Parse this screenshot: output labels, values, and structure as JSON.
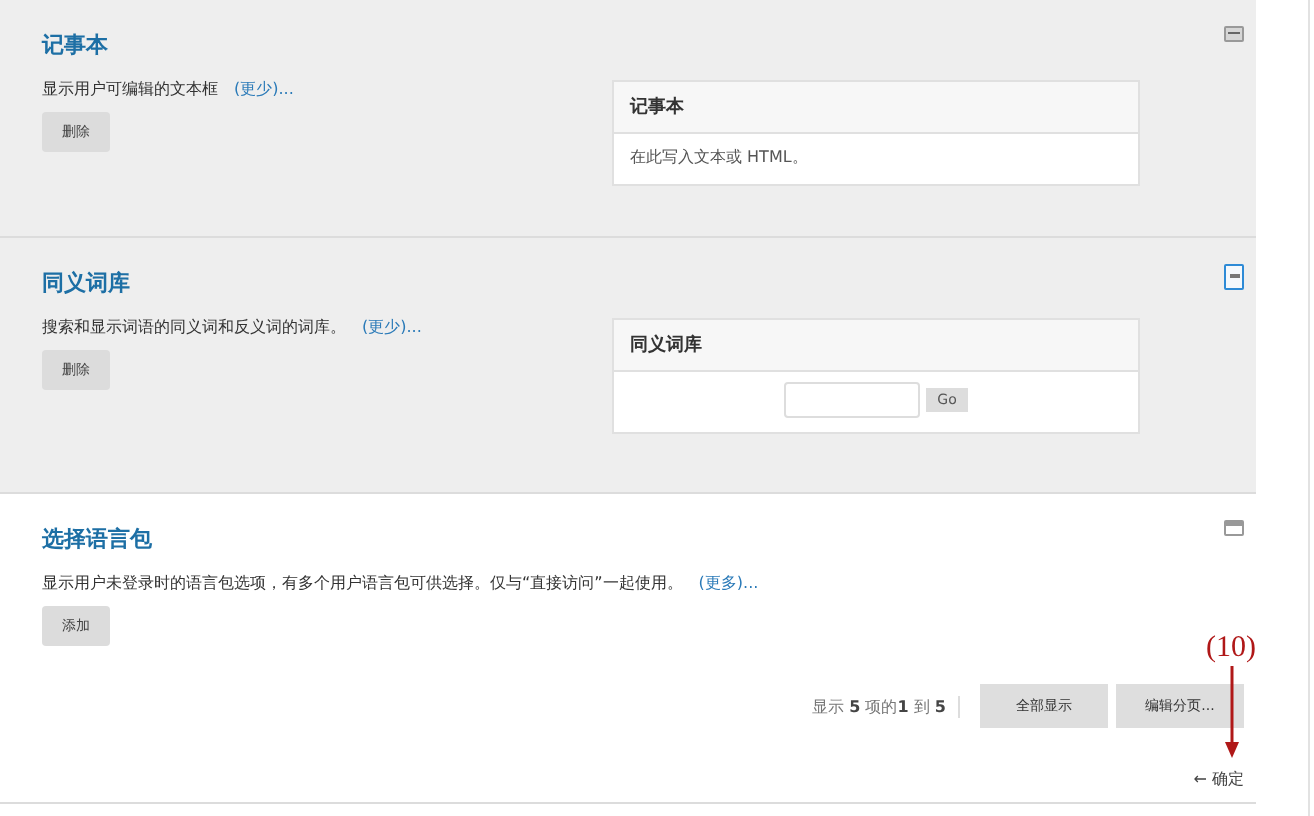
{
  "sections": [
    {
      "title": "记事本",
      "description": "显示用户可编辑的文本框",
      "more_link": "(更少)...",
      "button": "删除",
      "shaded": true,
      "toggle": {
        "kind": "collapse",
        "focused": false
      },
      "preview": {
        "title": "记事本",
        "kind": "text",
        "text": "在此写入文本或 HTML。"
      }
    },
    {
      "title": "同义词库",
      "description": "搜索和显示词语的同义词和反义词的词库。",
      "more_link": "(更少)...",
      "button": "删除",
      "shaded": true,
      "toggle": {
        "kind": "collapse",
        "focused": true
      },
      "preview": {
        "title": "同义词库",
        "kind": "search",
        "button": "Go"
      }
    },
    {
      "title": "选择语言包",
      "description": "显示用户未登录时的语言包选项，有多个用户语言包可供选择。仅与“直接访问”一起使用。",
      "more_link": "(更多)...",
      "button": "添加",
      "shaded": false,
      "toggle": {
        "kind": "expand",
        "focused": false
      }
    }
  ],
  "pagination": {
    "summary": "显示 **5** 项的**1** 到 **5**",
    "buttons": [
      "全部显示",
      "编辑分页..."
    ]
  },
  "annotation": {
    "label": "(10)"
  },
  "footer_link": "← 确定"
}
